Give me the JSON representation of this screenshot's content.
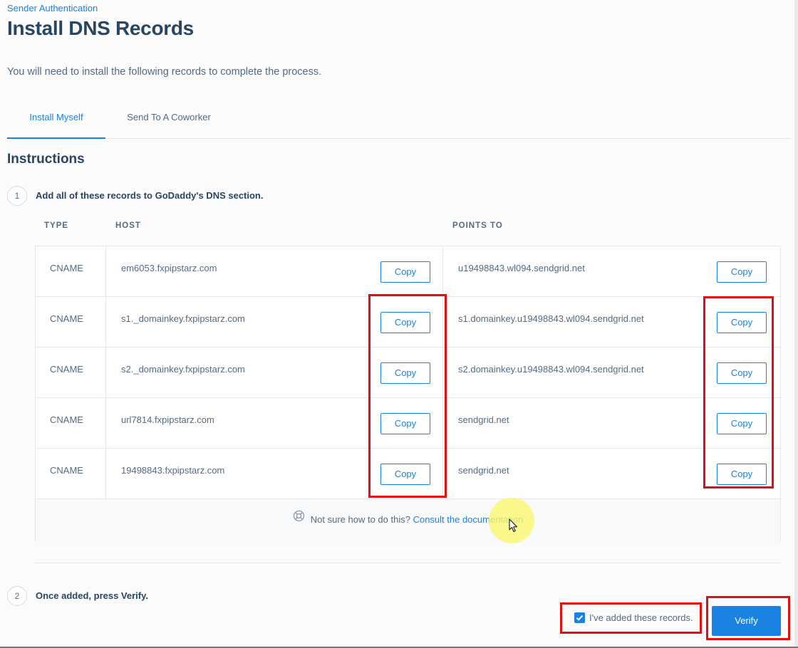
{
  "breadcrumb": "Sender Authentication",
  "title": "Install DNS Records",
  "subtitle": "You will need to install the following records to complete the process.",
  "tabs": [
    {
      "label": "Install Myself",
      "active": true
    },
    {
      "label": "Send To A Coworker",
      "active": false
    }
  ],
  "instructions_title": "Instructions",
  "step1": {
    "number": "1",
    "text": "Add all of these records to GoDaddy's DNS section."
  },
  "table": {
    "headers": {
      "type": "TYPE",
      "host": "HOST",
      "points_to": "POINTS TO"
    },
    "copy_label": "Copy",
    "rows": [
      {
        "type": "CNAME",
        "host": "em6053.fxpipstarz.com",
        "points_to": "u19498843.wl094.sendgrid.net"
      },
      {
        "type": "CNAME",
        "host": "s1._domainkey.fxpipstarz.com",
        "points_to": "s1.domainkey.u19498843.wl094.sendgrid.net"
      },
      {
        "type": "CNAME",
        "host": "s2._domainkey.fxpipstarz.com",
        "points_to": "s2.domainkey.u19498843.wl094.sendgrid.net"
      },
      {
        "type": "CNAME",
        "host": "url7814.fxpipstarz.com",
        "points_to": "sendgrid.net"
      },
      {
        "type": "CNAME",
        "host": "19498843.fxpipstarz.com",
        "points_to": "sendgrid.net"
      }
    ]
  },
  "help": {
    "icon": "lifebuoy-icon",
    "text": "Not sure how to do this?",
    "link": "Consult the documentation"
  },
  "step2": {
    "number": "2",
    "text": "Once added, press Verify."
  },
  "checkbox": {
    "label": "I've added these records.",
    "checked": true
  },
  "verify_label": "Verify",
  "colors": {
    "accent": "#1a82e2",
    "heading": "#294661",
    "highlight": "#e01010"
  }
}
